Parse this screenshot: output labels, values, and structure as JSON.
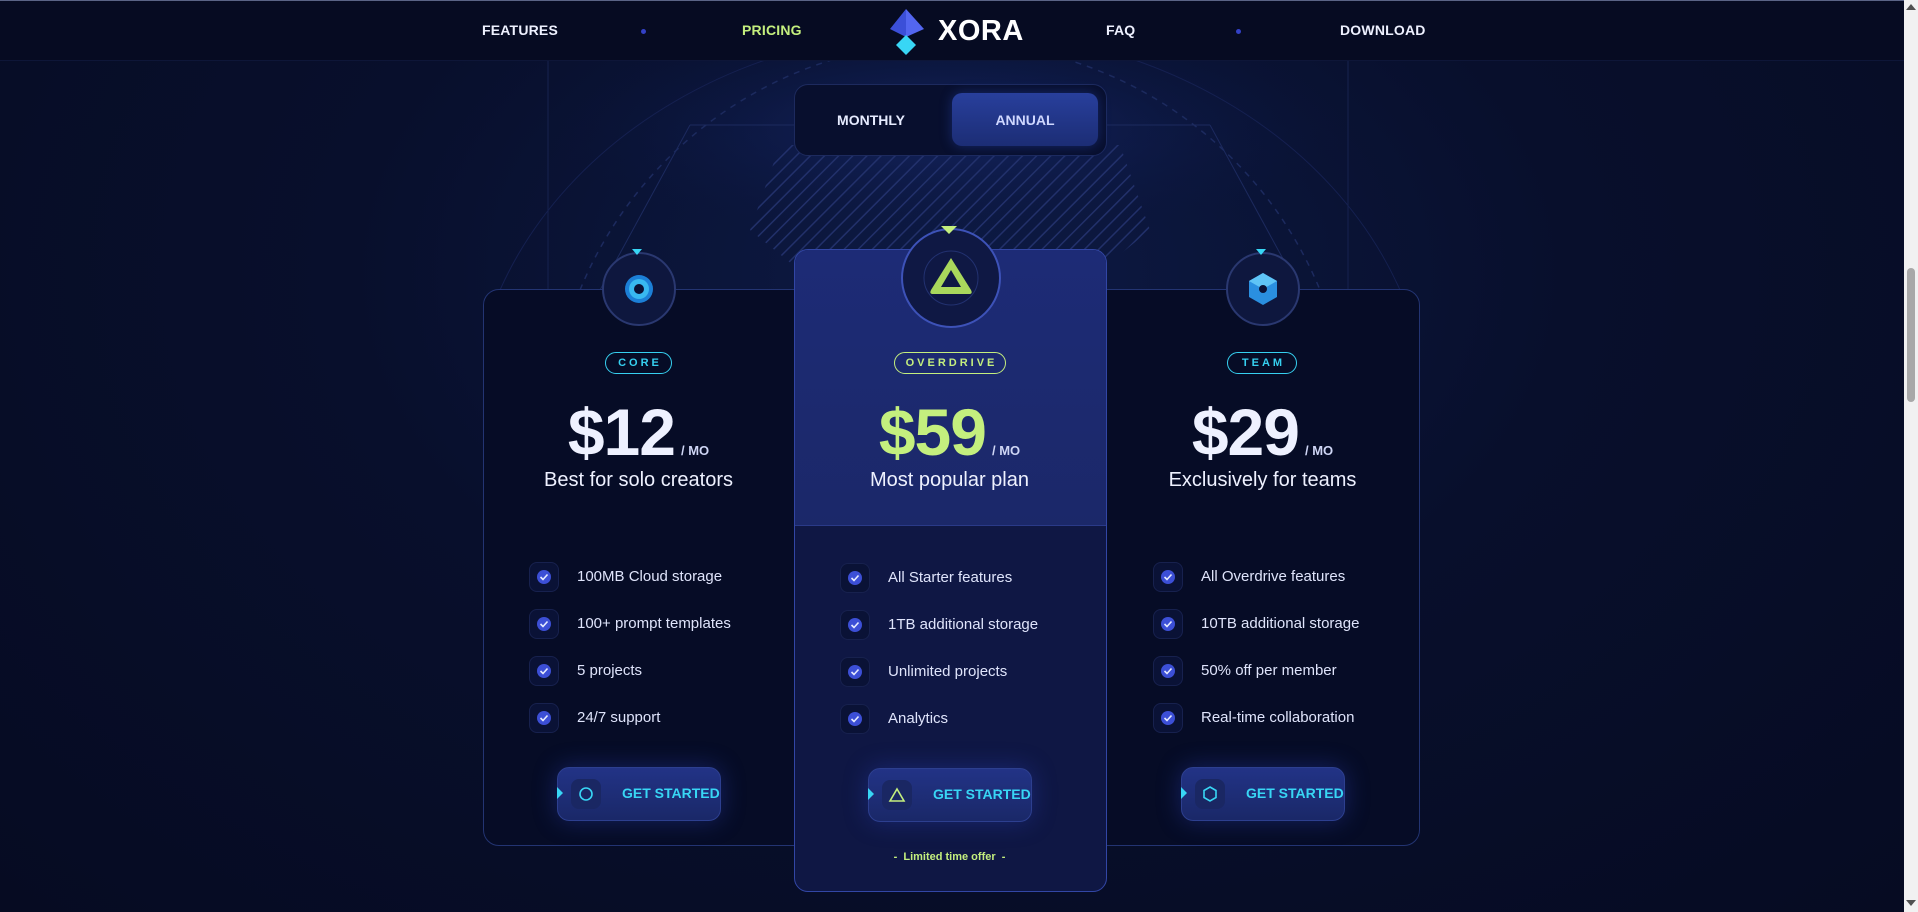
{
  "nav": {
    "left": [
      "FEATURES",
      "PRICING"
    ],
    "right": [
      "FAQ",
      "DOWNLOAD"
    ],
    "brand": "XORA",
    "active": "PRICING"
  },
  "billing": {
    "monthly": "MONTHLY",
    "annual": "ANNUAL",
    "selected": "ANNUAL"
  },
  "plans": [
    {
      "badge": "CORE",
      "price": "$12",
      "period": "/ MO",
      "tagline": "Best for solo creators",
      "features": [
        "100MB Cloud storage",
        "100+ prompt templates",
        "5 projects",
        "24/7 support"
      ],
      "cta": "GET STARTED",
      "icon": "ring-icon"
    },
    {
      "badge": "OVERDRIVE",
      "price": "$59",
      "period": "/ MO",
      "tagline": "Most popular plan",
      "features": [
        "All Starter features",
        "1TB additional storage",
        "Unlimited projects",
        "Analytics"
      ],
      "cta": "GET STARTED",
      "icon": "triangle-icon",
      "note": "Limited time offer"
    },
    {
      "badge": "TEAM",
      "price": "$29",
      "period": "/ MO",
      "tagline": "Exclusively for teams",
      "features": [
        "All Overdrive features",
        "10TB additional storage",
        "50% off per member",
        "Real-time collaboration"
      ],
      "cta": "GET STARTED",
      "icon": "hexagon-icon"
    }
  ],
  "colors": {
    "accent_cyan": "#38d6f5",
    "accent_green": "#c4ef7e",
    "bg": "#080f2c",
    "card_highlight": "#1d2b76"
  }
}
